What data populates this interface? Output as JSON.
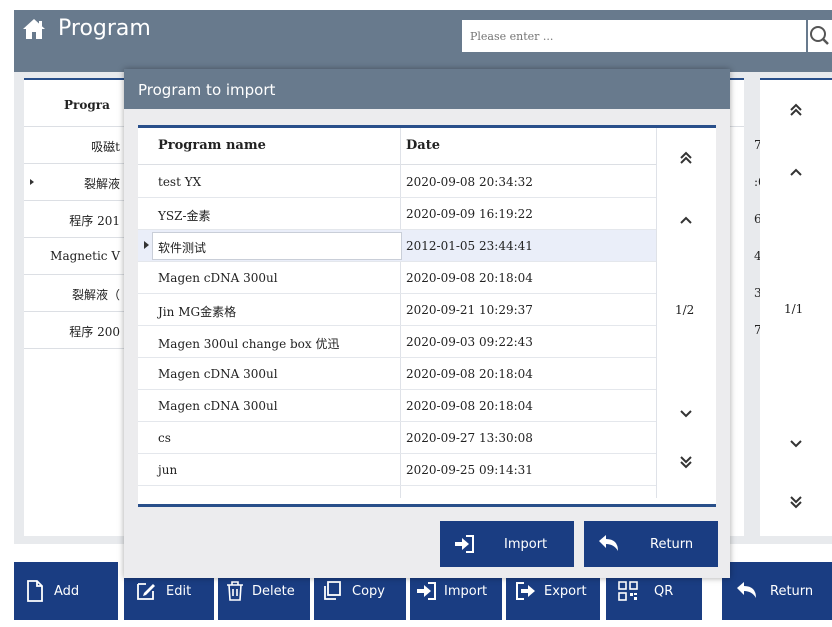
{
  "header": {
    "title": "Program",
    "search_placeholder": "Please enter ..."
  },
  "background_table": {
    "header_partial": "Progra",
    "rows": [
      {
        "name": "吸磁t",
        "date_tail": "7"
      },
      {
        "name": "裂解液",
        "date_tail": ":0"
      },
      {
        "name": "程序 201",
        "date_tail": "6"
      },
      {
        "name": "Magnetic V",
        "date_tail": "4"
      },
      {
        "name": "裂解液（",
        "date_tail": "3"
      },
      {
        "name": "程序 200",
        "date_tail": "7"
      }
    ],
    "page": "1/1"
  },
  "dialog": {
    "title": "Program to import",
    "columns": {
      "name": "Program name",
      "date": "Date"
    },
    "rows": [
      {
        "name": "test YX",
        "date": "2020-09-08 20:34:32"
      },
      {
        "name": "YSZ-金素",
        "date": "2020-09-09 16:19:22"
      },
      {
        "name": "软件测试",
        "date": "2012-01-05 23:44:41",
        "selected": true
      },
      {
        "name": "Magen cDNA 300ul",
        "date": "2020-09-08 20:18:04"
      },
      {
        "name": "Jin MG金素格",
        "date": "2020-09-21 10:29:37"
      },
      {
        "name": "Magen 300ul change box 优迅",
        "date": "2020-09-03 09:22:43"
      },
      {
        "name": "Magen cDNA 300ul",
        "date": "2020-09-08 20:18:04"
      },
      {
        "name": "Magen cDNA 300ul",
        "date": "2020-09-08 20:18:04"
      },
      {
        "name": "cs",
        "date": "2020-09-27 13:30:08"
      },
      {
        "name": "jun",
        "date": "2020-09-25 09:14:31"
      }
    ],
    "page": "1/2",
    "import_label": "Import",
    "return_label": "Return"
  },
  "toolbar": {
    "add": "Add",
    "edit": "Edit",
    "delete": "Delete",
    "copy": "Copy",
    "import": "Import",
    "export": "Export",
    "qr": "QR",
    "return": "Return"
  },
  "colors": {
    "header_bg": "#687a8d",
    "button_bg": "#1a3d82",
    "accent_line": "#294f8a"
  }
}
